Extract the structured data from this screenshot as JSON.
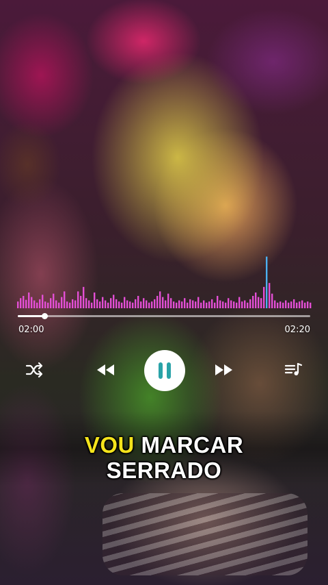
{
  "player": {
    "elapsed": "02:00",
    "total": "02:20",
    "progress_fraction": 0.09,
    "state": "playing",
    "accent_color": "#e44fd6",
    "peak_color": "#4bb0f0"
  },
  "controls": {
    "shuffle_icon": "shuffle-icon",
    "prev_icon": "rewind-icon",
    "play_pause_icon": "pause-icon",
    "next_icon": "fast-forward-icon",
    "queue_icon": "playlist-icon"
  },
  "visualizer": {
    "levels": [
      0.12,
      0.18,
      0.22,
      0.15,
      0.28,
      0.2,
      0.14,
      0.1,
      0.16,
      0.24,
      0.12,
      0.1,
      0.18,
      0.26,
      0.14,
      0.1,
      0.2,
      0.3,
      0.12,
      0.1,
      0.16,
      0.14,
      0.3,
      0.22,
      0.38,
      0.18,
      0.14,
      0.1,
      0.28,
      0.16,
      0.12,
      0.2,
      0.14,
      0.1,
      0.18,
      0.24,
      0.16,
      0.12,
      0.1,
      0.2,
      0.14,
      0.12,
      0.1,
      0.16,
      0.22,
      0.12,
      0.18,
      0.14,
      0.1,
      0.12,
      0.16,
      0.22,
      0.3,
      0.2,
      0.14,
      0.26,
      0.18,
      0.12,
      0.1,
      0.14,
      0.12,
      0.18,
      0.1,
      0.16,
      0.14,
      0.12,
      0.2,
      0.1,
      0.14,
      0.1,
      0.12,
      0.16,
      0.1,
      0.22,
      0.14,
      0.12,
      0.1,
      0.18,
      0.14,
      0.12,
      0.1,
      0.2,
      0.12,
      0.14,
      0.1,
      0.16,
      0.22,
      0.28,
      0.2,
      0.18,
      0.38,
      0.92,
      0.45,
      0.26,
      0.14,
      0.1,
      0.12,
      0.1,
      0.14,
      0.1,
      0.12,
      0.16,
      0.1,
      0.12,
      0.14,
      0.1,
      0.12,
      0.1
    ]
  },
  "lyrics": {
    "highlighted": "VOU",
    "rest_line1": " MARCAR",
    "line2": "SERRADO"
  }
}
